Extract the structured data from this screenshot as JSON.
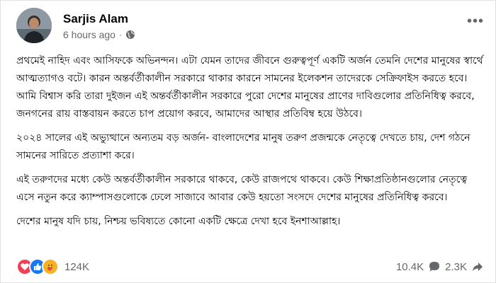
{
  "post": {
    "author": "Sarjis Alam",
    "timestamp": "6 hours ago",
    "audience_icon": "globe-icon",
    "more_icon": "more-options-icon",
    "paragraphs": [
      "প্রথমেই নাহিদ এবং আসিফকে অভিনন্দন। এটা যেমন তাদের জীবনে গুরুত্বপূর্ণ একটি অর্জন তেমনি দেশের মানুষের স্বার্থে আত্মত্যাগও বটে। কারন অন্তর্বর্তীকালীন সরকারে থাকার কারনে সামনের ইলেকশন তাদেরকে সেক্রিফাইস করতে হবে। আমি বিশ্বাস করি তারা দুইজন এই অন্তর্বর্তীকালীন সরকারে পুরো দেশের মানুষের প্রাণের দাবিগুলোর প্রতিনিধিত্ব করবে, জনগনের রায় বাস্তবায়ন করতে চাপ প্রয়োগ করবে, আমাদের আস্থার প্রতিবিম্ব হয়ে উঠবে।",
      "২০২৪ সালের এই অভ্যুত্থানে অন্যতম বড় অর্জন- বাংলাদেশের মানুষ তরুণ প্রজন্মকে নেতৃত্বে দেখতে চায়, দেশ গঠনে সামনের সারিতে প্রত্যাশা করে।",
      "এই তরুণদের মধ্যে কেউ অন্তর্বর্তীকালীন সরকারে থাকবে, কেউ রাজপথে থাকবে। কেউ শিক্ষাপ্রতিষ্ঠানগুলোর নেতৃত্বে এসে নতুন করে ক্যাম্পাসগুলোকে ঢেলে সাজাবে আবার কেউ হয়তো সংসদে দেশের মানুষের প্রতিনিধিত্ব করবে।",
      "দেশের মানুষ যদি চায়, নিশ্চয় ভবিষ্যতে কোনো একটি ক্ষেত্রে দেখা হবে ইনশাআল্লাহ।"
    ]
  },
  "footer": {
    "reactions": [
      "love",
      "like",
      "care"
    ],
    "reaction_count": "124K",
    "comment_count": "10.4K",
    "share_count": "2.3K"
  },
  "colors": {
    "love": "#f33e58",
    "like": "#1877f2",
    "care": "#f7b125",
    "text": "#050505",
    "muted": "#65676b"
  }
}
